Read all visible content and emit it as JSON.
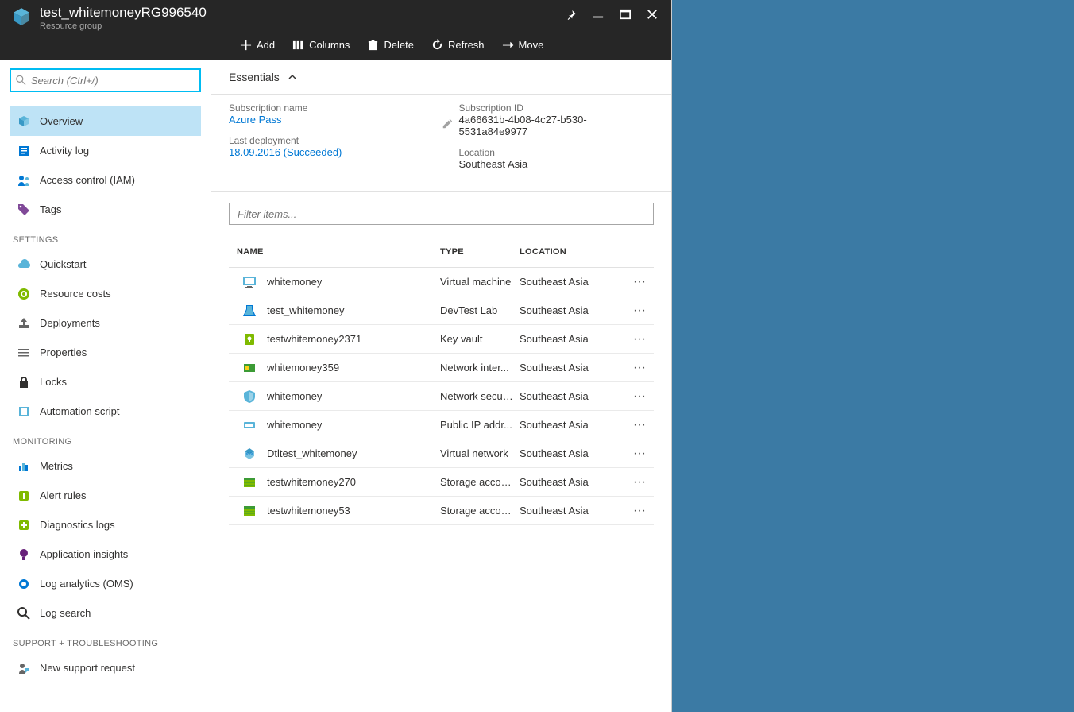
{
  "header": {
    "title": "test_whitemoneyRG996540",
    "subtitle": "Resource group"
  },
  "toolbar": {
    "add": "Add",
    "columns": "Columns",
    "delete": "Delete",
    "refresh": "Refresh",
    "move": "Move"
  },
  "sidebar": {
    "searchPlaceholder": "Search (Ctrl+/)",
    "top": [
      {
        "label": "Overview",
        "icon": "overview"
      },
      {
        "label": "Activity log",
        "icon": "activity"
      },
      {
        "label": "Access control (IAM)",
        "icon": "access"
      },
      {
        "label": "Tags",
        "icon": "tags"
      }
    ],
    "groups": [
      {
        "title": "SETTINGS",
        "items": [
          {
            "label": "Quickstart",
            "icon": "quickstart"
          },
          {
            "label": "Resource costs",
            "icon": "costs"
          },
          {
            "label": "Deployments",
            "icon": "deployments"
          },
          {
            "label": "Properties",
            "icon": "properties"
          },
          {
            "label": "Locks",
            "icon": "locks"
          },
          {
            "label": "Automation script",
            "icon": "script"
          }
        ]
      },
      {
        "title": "MONITORING",
        "items": [
          {
            "label": "Metrics",
            "icon": "metrics"
          },
          {
            "label": "Alert rules",
            "icon": "alerts"
          },
          {
            "label": "Diagnostics logs",
            "icon": "diag"
          },
          {
            "label": "Application insights",
            "icon": "insights"
          },
          {
            "label": "Log analytics (OMS)",
            "icon": "oms"
          },
          {
            "label": "Log search",
            "icon": "logsearch"
          }
        ]
      },
      {
        "title": "SUPPORT + TROUBLESHOOTING",
        "items": [
          {
            "label": "New support request",
            "icon": "support"
          }
        ]
      }
    ]
  },
  "essentials": {
    "header": "Essentials",
    "subscriptionNameLabel": "Subscription name",
    "subscriptionName": "Azure Pass",
    "lastDeploymentLabel": "Last deployment",
    "lastDeployment": "18.09.2016 (Succeeded)",
    "subscriptionIdLabel": "Subscription ID",
    "subscriptionId": "4a66631b-4b08-4c27-b530-5531a84e9977",
    "locationLabel": "Location",
    "location": "Southeast Asia"
  },
  "filterPlaceholder": "Filter items...",
  "columns": {
    "name": "NAME",
    "type": "TYPE",
    "location": "LOCATION"
  },
  "rows": [
    {
      "name": "whitemoney",
      "type": "Virtual machine",
      "location": "Southeast Asia",
      "icon": "vm"
    },
    {
      "name": "test_whitemoney",
      "type": "DevTest Lab",
      "location": "Southeast Asia",
      "icon": "devtest"
    },
    {
      "name": "testwhitemoney2371",
      "type": "Key vault",
      "location": "Southeast Asia",
      "icon": "keyvault"
    },
    {
      "name": "whitemoney359",
      "type": "Network inter...",
      "location": "Southeast Asia",
      "icon": "nic"
    },
    {
      "name": "whitemoney",
      "type": "Network secur...",
      "location": "Southeast Asia",
      "icon": "nsg"
    },
    {
      "name": "whitemoney",
      "type": "Public IP addr...",
      "location": "Southeast Asia",
      "icon": "pip"
    },
    {
      "name": "Dtltest_whitemoney",
      "type": "Virtual network",
      "location": "Southeast Asia",
      "icon": "vnet"
    },
    {
      "name": "testwhitemoney270",
      "type": "Storage account",
      "location": "Southeast Asia",
      "icon": "storage"
    },
    {
      "name": "testwhitemoney53",
      "type": "Storage account",
      "location": "Southeast Asia",
      "icon": "storage"
    }
  ]
}
